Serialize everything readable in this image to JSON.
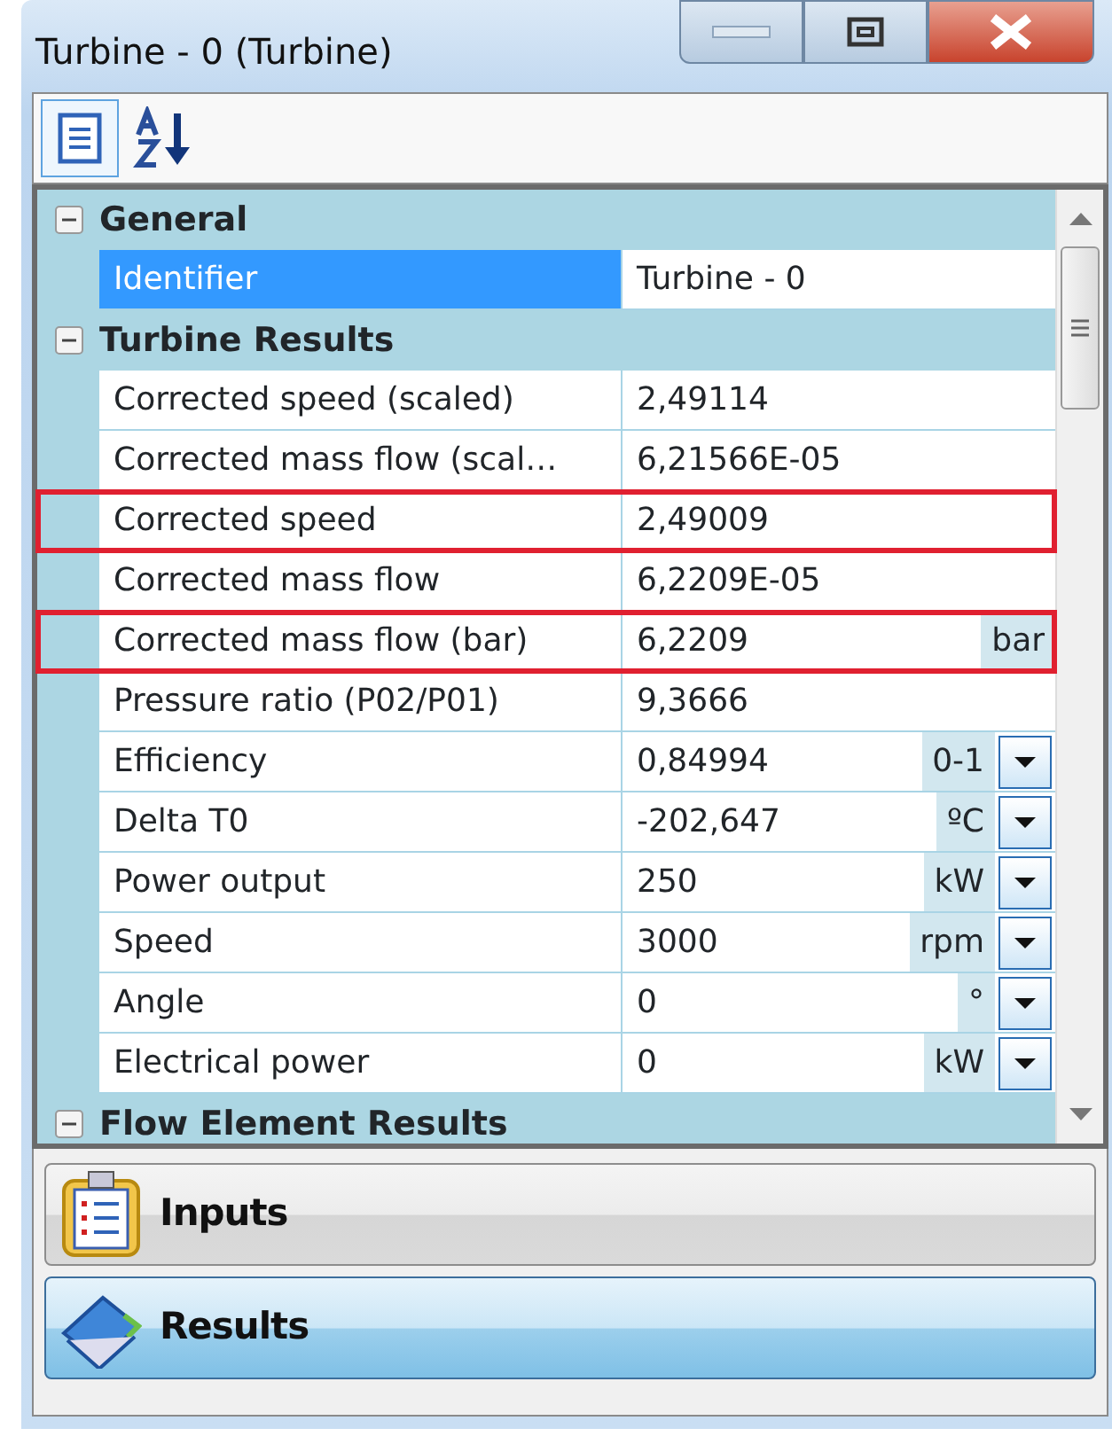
{
  "window": {
    "title": "Turbine - 0 (Turbine)"
  },
  "toolbar": [
    {
      "kind": "categorized",
      "selected": true
    },
    {
      "kind": "alphabetical",
      "selected": false
    }
  ],
  "categories": [
    {
      "title": "General",
      "expanded": true,
      "rows": [
        {
          "label": "Identifier",
          "value": "Turbine - 0",
          "selected": true,
          "highlighted": false
        }
      ]
    },
    {
      "title": "Turbine Results",
      "expanded": true,
      "rows": [
        {
          "label": "Corrected speed (scaled)",
          "value": "2,49114",
          "selected": false,
          "highlighted": false
        },
        {
          "label": "Corrected mass flow (scal…",
          "value": "6,21566E-05",
          "selected": false,
          "highlighted": false
        },
        {
          "label": "Corrected speed",
          "value": "2,49009",
          "selected": false,
          "highlighted": true
        },
        {
          "label": "Corrected mass flow",
          "value": "6,2209E-05",
          "selected": false,
          "highlighted": false
        },
        {
          "label": "Corrected mass flow (bar)",
          "value": "6,2209",
          "unit": "bar",
          "selected": false,
          "highlighted": true
        },
        {
          "label": "Pressure ratio (P02/P01)",
          "value": "9,3666",
          "selected": false,
          "highlighted": false
        },
        {
          "label": "Efficiency",
          "value": "0,84994",
          "unit": "0-1",
          "dropdown": true,
          "selected": false,
          "highlighted": false
        },
        {
          "label": "Delta T0",
          "value": "-202,647",
          "unit": "ºC",
          "dropdown": true,
          "selected": false,
          "highlighted": false
        },
        {
          "label": "Power output",
          "value": "250",
          "unit": "kW",
          "dropdown": true,
          "selected": false,
          "highlighted": false
        },
        {
          "label": "Speed",
          "value": "3000",
          "unit": "rpm",
          "dropdown": true,
          "selected": false,
          "highlighted": false
        },
        {
          "label": "Angle",
          "value": "0",
          "unit": "°",
          "dropdown": true,
          "selected": false,
          "highlighted": false
        },
        {
          "label": "Electrical power",
          "value": "0",
          "unit": "kW",
          "dropdown": true,
          "selected": false,
          "highlighted": false
        }
      ]
    },
    {
      "title": "Flow Element Results",
      "expanded": true
    }
  ],
  "panels": [
    {
      "kind": "inputs",
      "label": "Inputs",
      "selected": false
    },
    {
      "kind": "results",
      "label": "Results",
      "selected": true
    }
  ]
}
